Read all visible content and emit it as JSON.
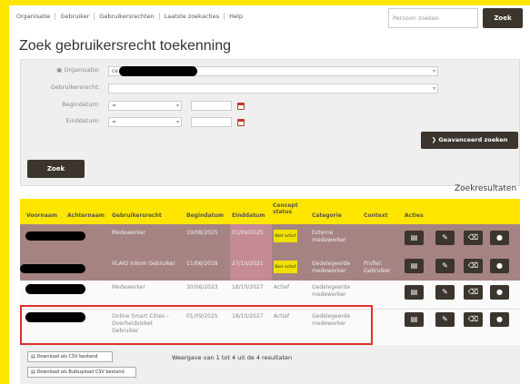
{
  "nav": {
    "items": [
      "Organisatie",
      "Gebruiker",
      "Gebruikersrechten",
      "Laatste zoekacties",
      "Help"
    ],
    "search_placeholder": "Persoon zoeken",
    "search_button": "Zoek"
  },
  "page": {
    "title": "Zoek gebruikersrecht toekenning"
  },
  "form": {
    "organisatie_label": "Organisatie:",
    "organisatie_value": "ce",
    "gebruikersrecht_label": "Gebruikersrecht:",
    "begindatum_label": "Begindatum:",
    "begindatum_op": "=",
    "einddatum_label": "Einddatum:",
    "einddatum_op": "=",
    "advanced_button": "Geavanceerd zoeken",
    "zoek_button": "Zoek"
  },
  "results": {
    "title": "Zoekresultaten",
    "columns": [
      "Voornaam",
      "Achternaam",
      "Gebruikersrecht",
      "Begindatum",
      "Einddatum",
      "Concept status",
      "Categorie",
      "Context",
      "Acties"
    ],
    "rows": [
      {
        "gebruikersrecht": "Medewerker",
        "begindatum": "19/08/2025",
        "einddatum": "01/09/2025",
        "status": "Niet actief",
        "categorie": "Externe medewerker",
        "context": ""
      },
      {
        "gebruikersrecht": "VLAIO Inkom Gebruiker",
        "begindatum": "11/06/2018",
        "einddatum": "27/10/2021",
        "status": "Niet actief",
        "categorie": "Gedelegeerde medewerker",
        "context": "Profiel: Gebruiker"
      },
      {
        "gebruikersrecht": "Medewerker",
        "begindatum": "30/06/2023",
        "einddatum": "18/10/2027",
        "status": "Actief",
        "categorie": "Gedelegeerde medewerker",
        "context": ""
      },
      {
        "gebruikersrecht": "Online Smart Cities – Overheidsloket Gebruiker",
        "begindatum": "01/09/2025",
        "einddatum": "18/10/2027",
        "status": "Actief",
        "categorie": "Gedelegeerde medewerker",
        "context": ""
      }
    ],
    "count_text": "Weergave van 1 tot 4 uit de 4 resultaten"
  },
  "downloads": {
    "csv": "Download als CSV bestand",
    "bulk": "Download als Bulkupload CSV bestand"
  }
}
